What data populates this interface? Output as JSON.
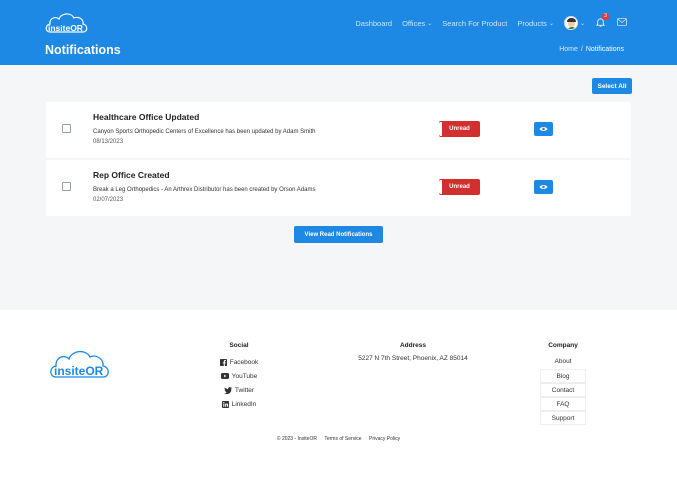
{
  "header": {
    "logo_text": "insiteOR",
    "nav": [
      {
        "label": "Dashboard",
        "dropdown": false
      },
      {
        "label": "Offices",
        "dropdown": true
      },
      {
        "label": "Search For Product",
        "dropdown": false
      },
      {
        "label": "Products",
        "dropdown": true
      }
    ],
    "notification_count": "3",
    "page_title": "Notifications",
    "breadcrumb": {
      "home": "Home",
      "separator": "/",
      "current": "Notifications"
    }
  },
  "main": {
    "select_all_label": "Select All",
    "notifications": [
      {
        "title": "Healthcare Office Updated",
        "description": "Canyon Sports Orthopedic Centers of Excellence has been updated by Adam Smith",
        "date": "08/13/2023",
        "status": "Unread"
      },
      {
        "title": "Rep Office Created",
        "description": "Break a Leg Orthopedics - An Arthrex Distributor has been created by Orson Adams",
        "date": "02/07/2023",
        "status": "Unread"
      }
    ],
    "view_read_label": "View Read Notifications"
  },
  "footer": {
    "logo_text": "insiteOR",
    "social": {
      "heading": "Social",
      "items": [
        {
          "label": "Facebook",
          "icon": "facebook-icon"
        },
        {
          "label": "YouTube",
          "icon": "youtube-icon"
        },
        {
          "label": "Twitter",
          "icon": "twitter-icon"
        },
        {
          "label": "LinkedIn",
          "icon": "linkedin-icon"
        }
      ]
    },
    "address": {
      "heading": "Address",
      "text": "5227 N 7th Street; Phoenix, AZ 85014"
    },
    "company": {
      "heading": "Company",
      "links": [
        "About",
        "Blog",
        "Contact",
        "FAQ",
        "Support"
      ]
    },
    "copyright": "© 2023 - InsiteOR",
    "terms": "Terms of Service",
    "privacy": "Privacy Policy"
  },
  "colors": {
    "primary": "#1e88e5",
    "unread": "#d32f2f",
    "background": "#f5f6f8"
  }
}
